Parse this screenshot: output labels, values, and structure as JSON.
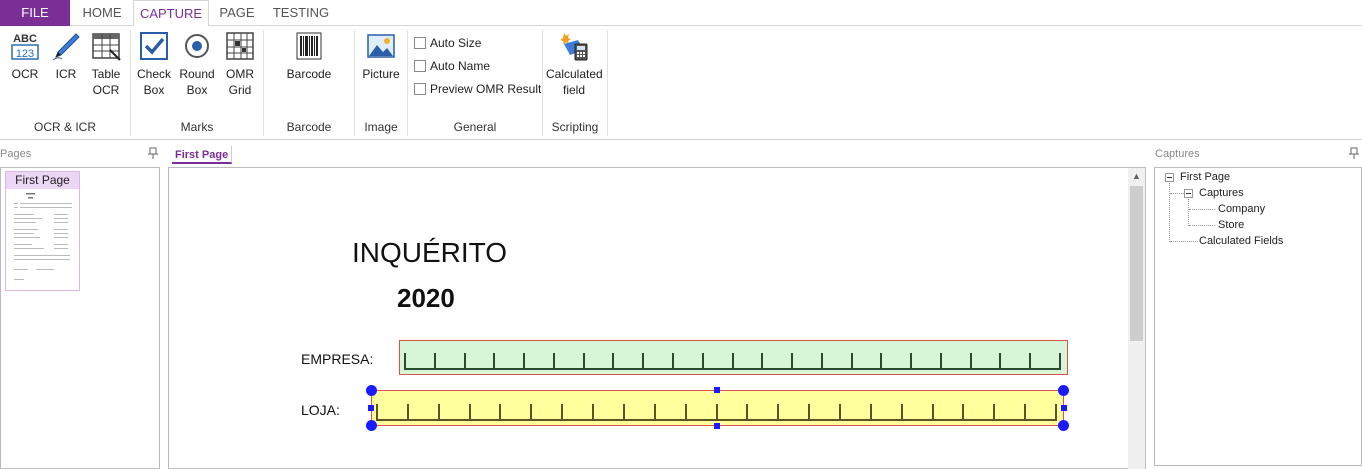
{
  "tabs": {
    "file": "FILE",
    "home": "HOME",
    "capture": "CAPTURE",
    "page": "PAGE",
    "testing": "TESTING"
  },
  "ribbon": {
    "ocr_icr": {
      "label": "OCR & ICR",
      "buttons": [
        {
          "label": "OCR",
          "icon": "ocr-abc-123-icon"
        },
        {
          "label": "ICR",
          "icon": "pen-icon"
        },
        {
          "label": "Table OCR",
          "icon": "table-icon"
        }
      ]
    },
    "marks": {
      "label": "Marks",
      "buttons": [
        {
          "label": "Check Box",
          "icon": "checkbox-icon"
        },
        {
          "label": "Round Box",
          "icon": "radio-icon"
        },
        {
          "label": "OMR Grid",
          "icon": "grid-icon"
        }
      ]
    },
    "barcode": {
      "label": "Barcode",
      "buttons": [
        {
          "label": "Barcode",
          "icon": "barcode-icon"
        }
      ]
    },
    "image": {
      "label": "Image",
      "buttons": [
        {
          "label": "Picture",
          "icon": "picture-icon"
        }
      ]
    },
    "general": {
      "label": "General",
      "checkboxes": [
        {
          "label": "Auto Size",
          "checked": false
        },
        {
          "label": "Auto Name",
          "checked": false
        },
        {
          "label": "Preview OMR Result",
          "checked": false
        }
      ]
    },
    "scripting": {
      "label": "Scripting",
      "buttons": [
        {
          "label": "Calculated field",
          "icon": "calculator-icon"
        }
      ]
    }
  },
  "pages_panel": {
    "title": "Pages",
    "thumbnails": [
      {
        "label": "First Page"
      }
    ]
  },
  "document": {
    "tab": "First Page",
    "title": "INQUÉRITO",
    "year": "2020",
    "fields": [
      {
        "label": "EMPRESA:"
      },
      {
        "label": "LOJA:"
      }
    ]
  },
  "captures_panel": {
    "title": "Captures",
    "tree": {
      "root": "First Page",
      "captures": "Captures",
      "company": "Company",
      "store": "Store",
      "calculated": "Calculated Fields"
    }
  },
  "colors": {
    "accent": "#7b2f96",
    "company_zone": "#d7f5d7",
    "store_zone": "#ffff9e",
    "zone_border": "#e05050",
    "handles": "#1a1aff"
  }
}
